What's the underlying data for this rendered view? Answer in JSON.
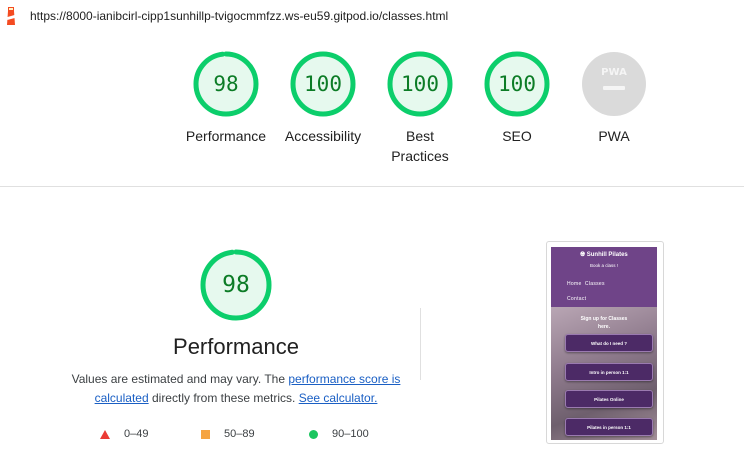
{
  "url": "https://8000-ianibcirl-cipp1sunhillp-tvigocmmfzz.ws-eu59.gitpod.io/classes.html",
  "categories": [
    {
      "score": "98",
      "label": "Performance",
      "fraction": 0.98
    },
    {
      "score": "100",
      "label": "Accessibility",
      "fraction": 1.0
    },
    {
      "score": "100",
      "label": "Best Practices",
      "fraction": 1.0
    },
    {
      "score": "100",
      "label": "SEO",
      "fraction": 1.0
    },
    {
      "score": "PWA",
      "label": "PWA",
      "fraction": 0
    }
  ],
  "performance": {
    "score": "98",
    "fraction": 0.98,
    "title": "Performance",
    "desc_before": "Values are estimated and may vary. The ",
    "link_score": "performance score is calculated",
    "desc_middle": " directly from these metrics. ",
    "link_calc": "See calculator."
  },
  "legend": {
    "fail": "0–49",
    "average": "50–89",
    "pass": "90–100"
  },
  "colors": {
    "pass": "#0cce6b",
    "pass_text": "#0c7c26",
    "pass_bg": "#e6f9ee",
    "fail": "#eb3b35",
    "average": "#f5a442",
    "pwa_bg": "#dadada"
  },
  "screenshot": {
    "brand": "Sunhill Pilates",
    "book": "Book a class !",
    "nav_row1": "Home  Classes",
    "nav_row2": "Contact",
    "hero_line1": "Sign up for Classes",
    "hero_line2": "here.",
    "buttons": [
      "What do I need ?",
      "Intro in person 1:1",
      "Pilates Online",
      "Pilates in person 1:1"
    ]
  }
}
